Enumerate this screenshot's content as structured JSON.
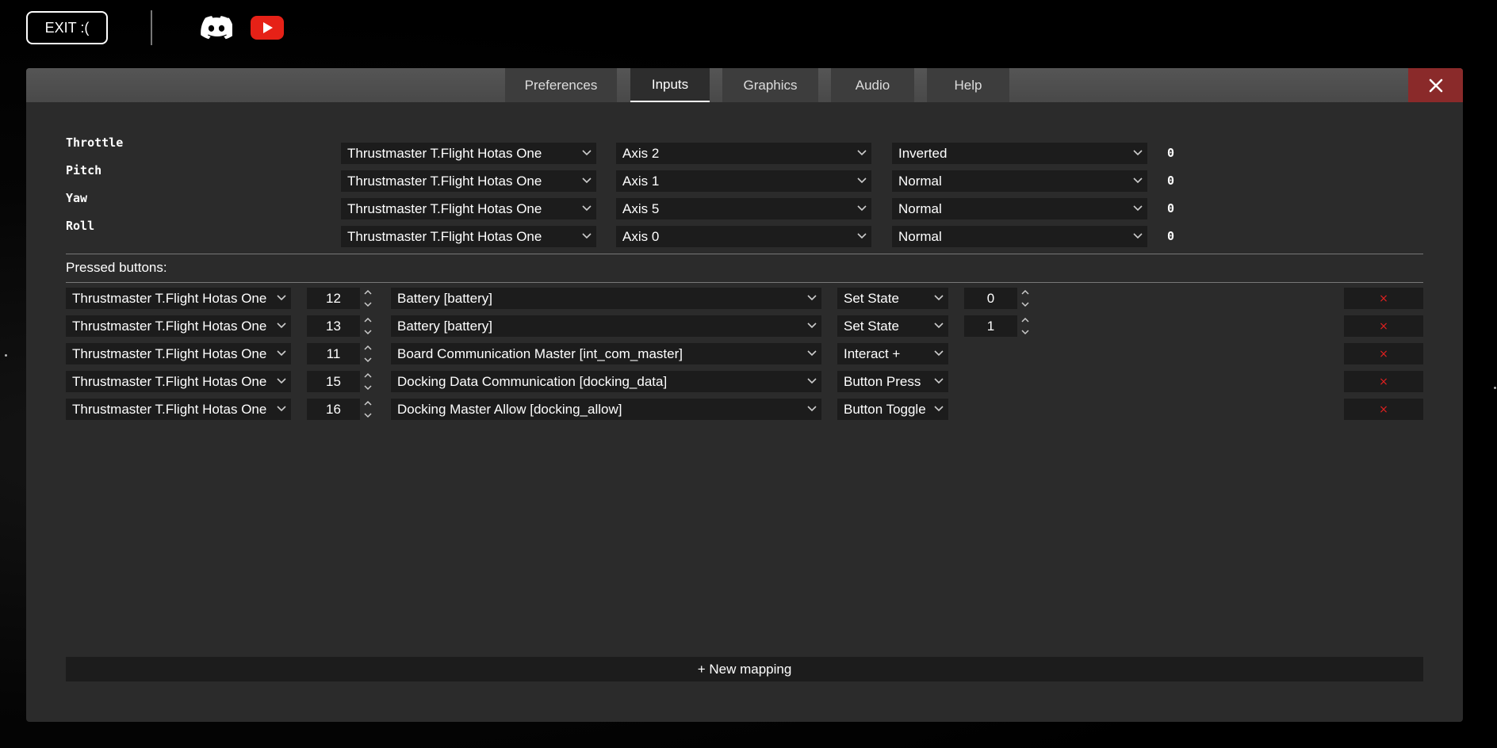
{
  "topbar": {
    "exit_label": "EXIT :(",
    "discord_icon": "discord-icon",
    "youtube_icon": "youtube-icon"
  },
  "tabs": [
    {
      "label": "Preferences",
      "active": false
    },
    {
      "label": "Inputs",
      "active": true
    },
    {
      "label": "Graphics",
      "active": false
    },
    {
      "label": "Audio",
      "active": false
    },
    {
      "label": "Help",
      "active": false
    }
  ],
  "close_icon": "close-icon",
  "axes": [
    {
      "label": "Throttle",
      "device": "Thrustmaster T.Flight Hotas One",
      "axis": "Axis 2",
      "mode": "Inverted",
      "value": "0"
    },
    {
      "label": "Pitch",
      "device": "Thrustmaster T.Flight Hotas One",
      "axis": "Axis 1",
      "mode": "Normal",
      "value": "0"
    },
    {
      "label": "Yaw",
      "device": "Thrustmaster T.Flight Hotas One",
      "axis": "Axis 5",
      "mode": "Normal",
      "value": "0"
    },
    {
      "label": "Roll",
      "device": "Thrustmaster T.Flight Hotas One",
      "axis": "Axis 0",
      "mode": "Normal",
      "value": "0"
    }
  ],
  "pressed_buttons_label": "Pressed buttons:",
  "buttons": [
    {
      "device": "Thrustmaster T.Flight Hotas One",
      "button": "12",
      "action": "Battery [battery]",
      "type": "Set State",
      "state": "0"
    },
    {
      "device": "Thrustmaster T.Flight Hotas One",
      "button": "13",
      "action": "Battery [battery]",
      "type": "Set State",
      "state": "1"
    },
    {
      "device": "Thrustmaster T.Flight Hotas One",
      "button": "11",
      "action": "Board Communication Master [int_com_master]",
      "type": "Interact +"
    },
    {
      "device": "Thrustmaster T.Flight Hotas One",
      "button": "15",
      "action": "Docking Data Communication [docking_data]",
      "type": "Button Press"
    },
    {
      "device": "Thrustmaster T.Flight Hotas One",
      "button": "16",
      "action": "Docking Master Allow [docking_allow]",
      "type": "Button Toggle"
    }
  ],
  "delete_label": "×",
  "new_mapping_label": "+ New mapping",
  "colors": {
    "accent_close": "#8a2a2a",
    "delete_red": "#e02020",
    "youtube": "#e62117"
  }
}
